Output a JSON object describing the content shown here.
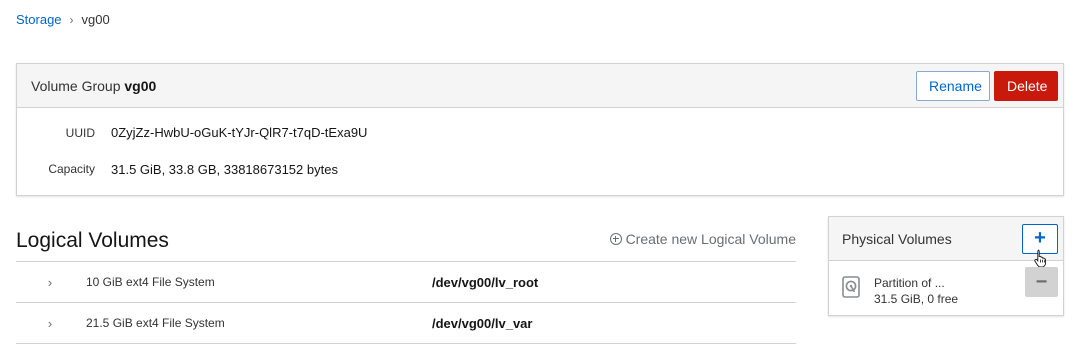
{
  "breadcrumb": {
    "root": "Storage",
    "current": "vg00"
  },
  "volume_group": {
    "prefix": "Volume Group",
    "name": "vg00",
    "rename_label": "Rename",
    "delete_label": "Delete",
    "uuid_label": "UUID",
    "uuid_value": "0ZyjZz-HwbU-oGuK-tYJr-QlR7-t7qD-tExa9U",
    "capacity_label": "Capacity",
    "capacity_value": "31.5 GiB, 33.8 GB, 33818673152 bytes"
  },
  "logical_volumes": {
    "title": "Logical Volumes",
    "create_label": "Create new Logical Volume",
    "rows": [
      {
        "description": "10 GiB ext4 File System",
        "path": "/dev/vg00/lv_root"
      },
      {
        "description": "21.5 GiB ext4 File System",
        "path": "/dev/vg00/lv_var"
      }
    ]
  },
  "physical_volumes": {
    "title": "Physical Volumes",
    "add_label": "+",
    "remove_label": "−",
    "items": [
      {
        "name": "Partition of ...",
        "size": "31.5 GiB, 0 free"
      }
    ]
  },
  "colors": {
    "link": "#0066cc",
    "danger": "#c9190b",
    "header_bg": "#f5f5f5",
    "border": "#d2d2d2"
  },
  "icons": {
    "breadcrumb_separator": "chevron-right-icon",
    "create": "plus-circle-icon",
    "expand": "chevron-right-icon",
    "disk": "hard-disk-icon",
    "cursor": "hand-pointer-icon"
  }
}
